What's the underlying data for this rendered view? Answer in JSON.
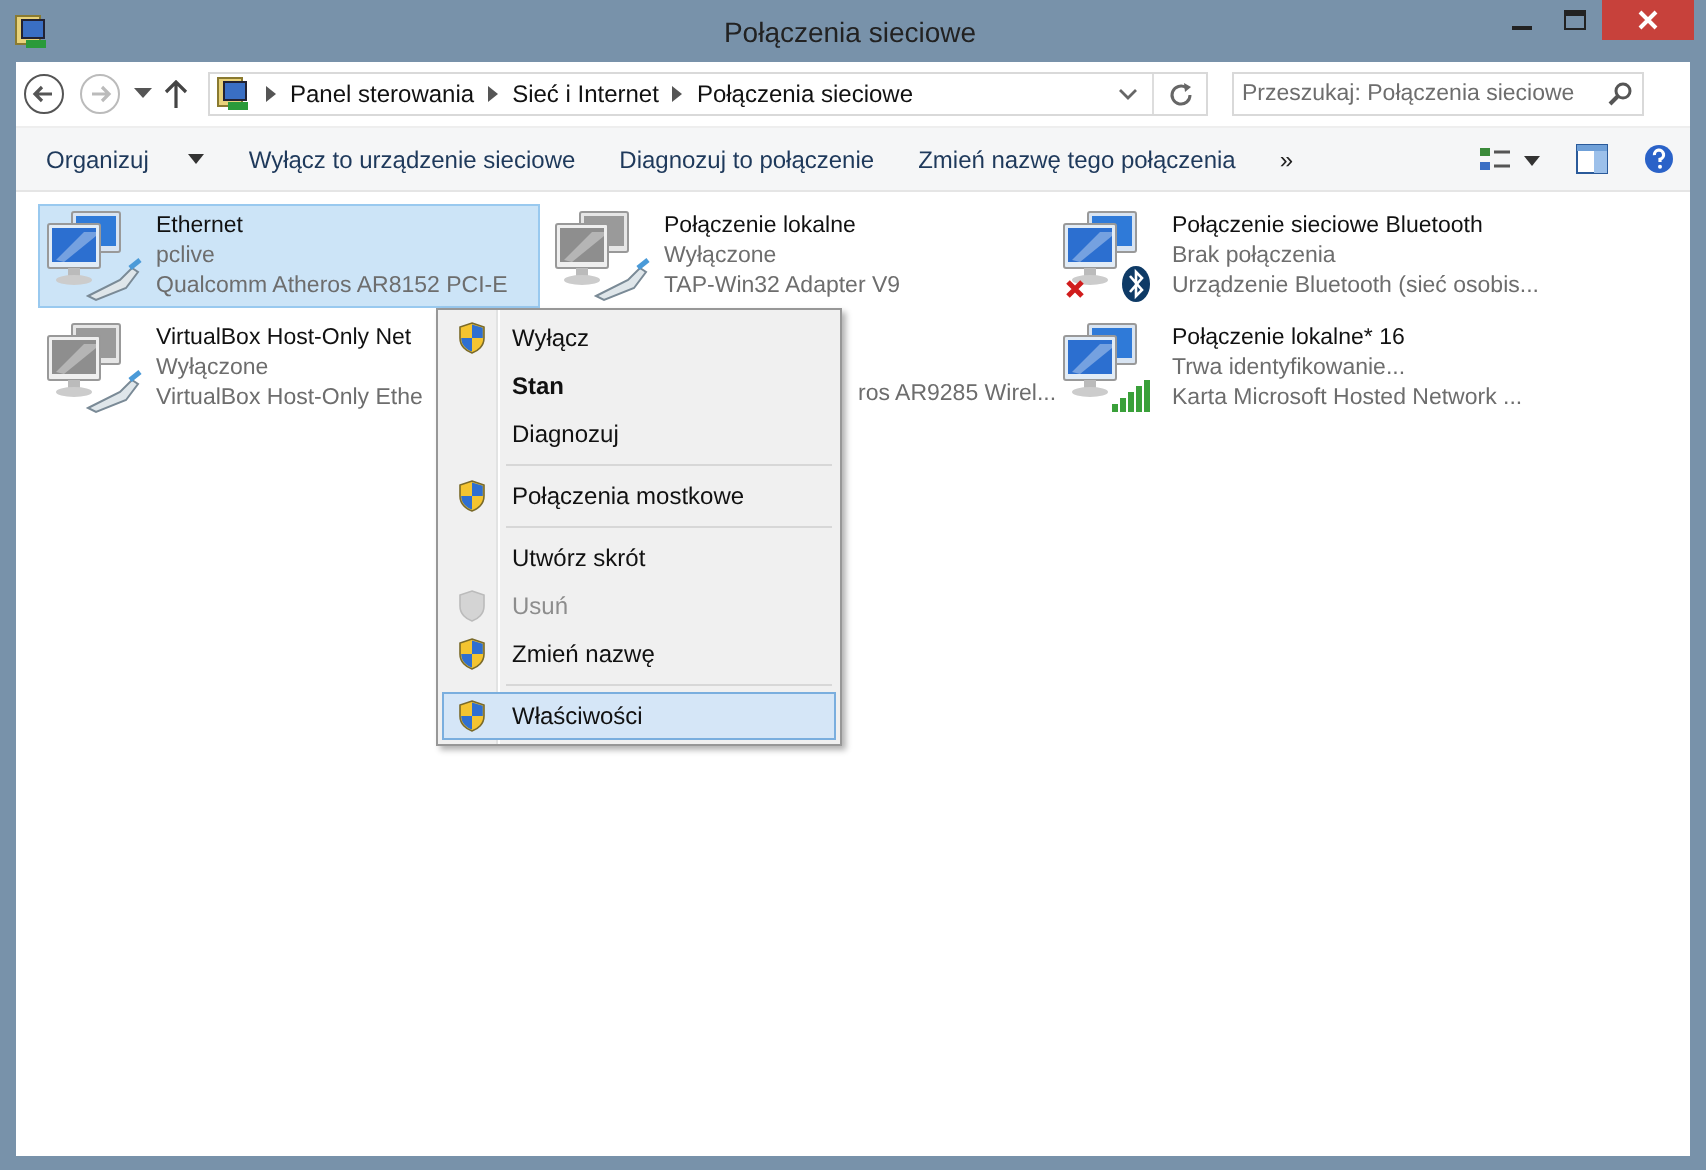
{
  "window": {
    "title": "Połączenia sieciowe"
  },
  "address": {
    "segments": [
      "Panel sterowania",
      "Sieć i Internet",
      "Połączenia sieciowe"
    ]
  },
  "search": {
    "placeholder": "Przeszukaj: Połączenia sieciowe"
  },
  "toolbar": {
    "buttons": [
      {
        "label": "Organizuj",
        "dropdown": true
      },
      {
        "label": "Wyłącz to urządzenie sieciowe",
        "dropdown": false
      },
      {
        "label": "Diagnozuj to połączenie",
        "dropdown": false
      },
      {
        "label": "Zmień nazwę tego połączenia",
        "dropdown": false
      }
    ],
    "more": "»"
  },
  "connections": [
    {
      "kind": "cable",
      "name": "Ethernet",
      "status": "pclive",
      "description": "Qualcomm Atheros AR8152 PCI-E",
      "enabled": true,
      "selected": true
    },
    {
      "kind": "cable",
      "name": "Połączenie lokalne",
      "status": "Wyłączone",
      "description": "TAP-Win32 Adapter V9",
      "enabled": false,
      "selected": false
    },
    {
      "kind": "bluetooth",
      "name": "Połączenie sieciowe Bluetooth",
      "status": "Brak połączenia",
      "description": "Urządzenie Bluetooth (sieć osobis...",
      "enabled": true,
      "selected": false
    },
    {
      "kind": "cable",
      "name": "VirtualBox Host-Only Net",
      "status": "Wyłączone",
      "description": "VirtualBox Host-Only Ethe",
      "enabled": false,
      "selected": false
    },
    {
      "kind": "covered",
      "description": "ros AR9285 Wirel..."
    },
    {
      "kind": "signal",
      "name": "Połączenie lokalne* 16",
      "status": "Trwa identyfikowanie...",
      "description": "Karta Microsoft Hosted Network ...",
      "enabled": true,
      "selected": false
    }
  ],
  "context_menu": [
    {
      "kind": "item",
      "label": "Wyłącz",
      "shield": true,
      "bold": false,
      "disabled": false,
      "selected": false
    },
    {
      "kind": "item",
      "label": "Stan",
      "shield": false,
      "bold": true,
      "disabled": false,
      "selected": false
    },
    {
      "kind": "item",
      "label": "Diagnozuj",
      "shield": false,
      "bold": false,
      "disabled": false,
      "selected": false
    },
    {
      "kind": "separator"
    },
    {
      "kind": "item",
      "label": "Połączenia mostkowe",
      "shield": true,
      "bold": false,
      "disabled": false,
      "selected": false
    },
    {
      "kind": "separator"
    },
    {
      "kind": "item",
      "label": "Utwórz skrót",
      "shield": false,
      "bold": false,
      "disabled": false,
      "selected": false
    },
    {
      "kind": "item",
      "label": "Usuń",
      "shield": true,
      "bold": false,
      "disabled": true,
      "selected": false
    },
    {
      "kind": "item",
      "label": "Zmień nazwę",
      "shield": true,
      "bold": false,
      "disabled": false,
      "selected": false
    },
    {
      "kind": "separator"
    },
    {
      "kind": "item",
      "label": "Właściwości",
      "shield": true,
      "bold": false,
      "disabled": false,
      "selected": true
    }
  ]
}
